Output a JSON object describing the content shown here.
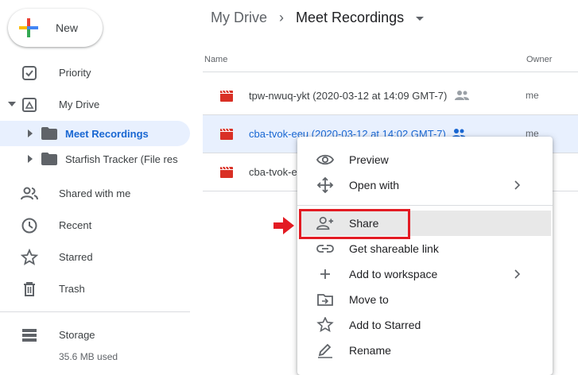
{
  "sidebar": {
    "new_label": "New",
    "items": [
      {
        "label": "Priority",
        "icon": "priority-check-icon"
      },
      {
        "label": "My Drive",
        "icon": "drive-icon"
      },
      {
        "label": "Meet Recordings",
        "icon": "folder-icon"
      },
      {
        "label": "Starfish Tracker (File res",
        "icon": "folder-icon"
      },
      {
        "label": "Shared with me",
        "icon": "people-icon"
      },
      {
        "label": "Recent",
        "icon": "clock-icon"
      },
      {
        "label": "Starred",
        "icon": "star-icon"
      },
      {
        "label": "Trash",
        "icon": "trash-icon"
      }
    ],
    "storage": {
      "label": "Storage",
      "used": "35.6 MB used"
    }
  },
  "breadcrumb": {
    "root": "My Drive",
    "separator": "›",
    "current": "Meet Recordings"
  },
  "table": {
    "columns": {
      "name": "Name",
      "owner": "Owner"
    },
    "rows": [
      {
        "name": "tpw-nwuq-ykt (2020-03-12 at 14:09 GMT-7)",
        "owner": "me",
        "selected": false
      },
      {
        "name": "cba-tvok-eeu (2020-03-12 at 14:02 GMT-7)",
        "owner": "me",
        "selected": true
      },
      {
        "name": "cba-tvok-e",
        "owner": "",
        "selected": false
      }
    ]
  },
  "context_menu": {
    "items": [
      {
        "label": "Preview",
        "icon": "eye-icon"
      },
      {
        "label": "Open with",
        "icon": "move-arrows-icon",
        "submenu": true
      },
      {
        "label": "Share",
        "icon": "add-person-icon",
        "highlighted": true
      },
      {
        "label": "Get shareable link",
        "icon": "link-icon"
      },
      {
        "label": "Add to workspace",
        "icon": "plus-icon",
        "submenu": true
      },
      {
        "label": "Move to",
        "icon": "move-folder-icon"
      },
      {
        "label": "Add to Starred",
        "icon": "star-outline-icon"
      },
      {
        "label": "Rename",
        "icon": "pencil-icon"
      }
    ]
  },
  "colors": {
    "accent": "#1967d2",
    "selection": "#e8f0fe",
    "annotation_red": "#e31b23",
    "video_red": "#d93025"
  }
}
